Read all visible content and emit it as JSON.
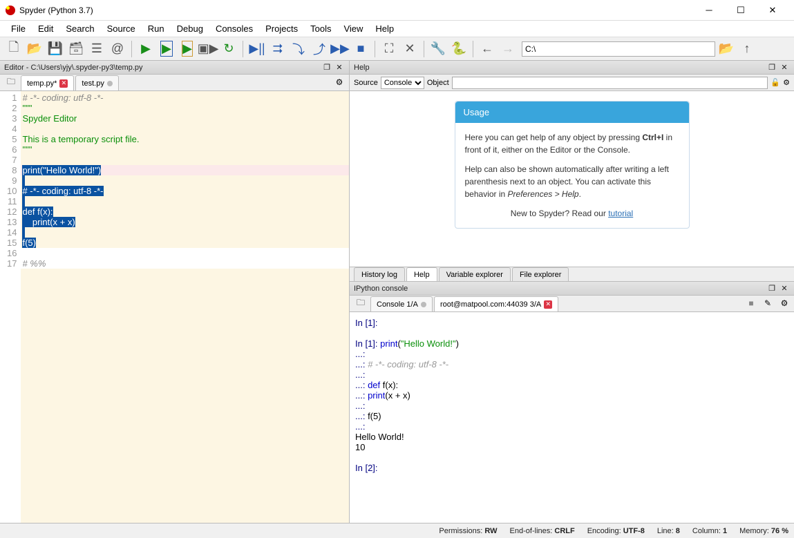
{
  "window": {
    "title": "Spyder (Python 3.7)"
  },
  "menubar": [
    "File",
    "Edit",
    "Search",
    "Source",
    "Run",
    "Debug",
    "Consoles",
    "Projects",
    "Tools",
    "View",
    "Help"
  ],
  "toolbar": {
    "path": "C:\\"
  },
  "editor": {
    "pane_title": "Editor - C:\\Users\\yjy\\.spyder-py3\\temp.py",
    "tabs": [
      {
        "label": "temp.py*",
        "modified": true,
        "active": true
      },
      {
        "label": "test.py",
        "modified": false,
        "active": false
      }
    ],
    "lines": [
      {
        "n": 1,
        "raw": "# -*- coding: utf-8 -*-",
        "cls": "c-gray"
      },
      {
        "n": 2,
        "raw": "\"\"\"",
        "cls": "c-green"
      },
      {
        "n": 3,
        "raw": "Spyder Editor",
        "cls": "c-green"
      },
      {
        "n": 4,
        "raw": "",
        "cls": "c-green"
      },
      {
        "n": 5,
        "raw": "This is a temporary script file.",
        "cls": "c-green"
      },
      {
        "n": 6,
        "raw": "\"\"\"",
        "cls": "c-green"
      },
      {
        "n": 7,
        "raw": "",
        "cls": ""
      },
      {
        "n": 8,
        "raw": "print(\"Hello World!\")",
        "cls": "",
        "sel": true,
        "hl": true
      },
      {
        "n": 9,
        "raw": "",
        "cls": "",
        "sel": true
      },
      {
        "n": 10,
        "raw": "# -*- coding: utf-8 -*-",
        "cls": "c-gray",
        "sel": true
      },
      {
        "n": 11,
        "raw": "",
        "cls": "",
        "sel": true
      },
      {
        "n": 12,
        "raw": "def f(x):",
        "cls": "",
        "sel": true
      },
      {
        "n": 13,
        "raw": "    print(x + x)",
        "cls": "",
        "sel": true
      },
      {
        "n": 14,
        "raw": "",
        "cls": "",
        "sel": true
      },
      {
        "n": 15,
        "raw": "f(5)",
        "cls": "",
        "sel": true
      },
      {
        "n": 16,
        "raw": "",
        "cls": "",
        "plain": true
      },
      {
        "n": 17,
        "raw": "# %%",
        "cls": "c-gray",
        "plain": true
      }
    ]
  },
  "help": {
    "pane_title": "Help",
    "source_label": "Source",
    "source_value": "Console",
    "object_label": "Object",
    "object_value": "",
    "card_title": "Usage",
    "p1": "Here you can get help of any object by pressing Ctrl+I in front of it, either on the Editor or the Console.",
    "p2": "Help can also be shown automatically after writing a left parenthesis next to an object. You can activate this behavior in Preferences > Help.",
    "tutorial_prefix": "New to Spyder? Read our ",
    "tutorial_link": "tutorial",
    "inner_tabs": [
      "History log",
      "Help",
      "Variable explorer",
      "File explorer"
    ],
    "inner_active": "Help"
  },
  "ipython": {
    "pane_title": "IPython console",
    "tabs": [
      {
        "label": "Console 1/A",
        "close": "gray"
      },
      {
        "label": "root@matpool.com:44039 3/A",
        "close": "red",
        "active": true
      }
    ],
    "content": [
      {
        "t": "prompt",
        "text": "In [1]:"
      },
      {
        "t": "blank"
      },
      {
        "t": "in",
        "n": "1",
        "code": "print(\"Hello World!\")"
      },
      {
        "t": "cont",
        "code": ""
      },
      {
        "t": "cont",
        "code": "# -*- coding: utf-8 -*-",
        "style": "comment"
      },
      {
        "t": "cont",
        "code": ""
      },
      {
        "t": "cont",
        "code": "def f(x):"
      },
      {
        "t": "cont",
        "code": "    print(x + x)"
      },
      {
        "t": "cont",
        "code": ""
      },
      {
        "t": "cont",
        "code": "f(5)"
      },
      {
        "t": "cont",
        "code": ""
      },
      {
        "t": "out",
        "text": "Hello World!"
      },
      {
        "t": "out",
        "text": "10"
      },
      {
        "t": "blank"
      },
      {
        "t": "prompt",
        "text": "In [2]:"
      }
    ]
  },
  "statusbar": {
    "permissions_label": "Permissions:",
    "permissions": "RW",
    "eol_label": "End-of-lines:",
    "eol": "CRLF",
    "encoding_label": "Encoding:",
    "encoding": "UTF-8",
    "line_label": "Line:",
    "line": "8",
    "column_label": "Column:",
    "column": "1",
    "memory_label": "Memory:",
    "memory": "76 %"
  }
}
